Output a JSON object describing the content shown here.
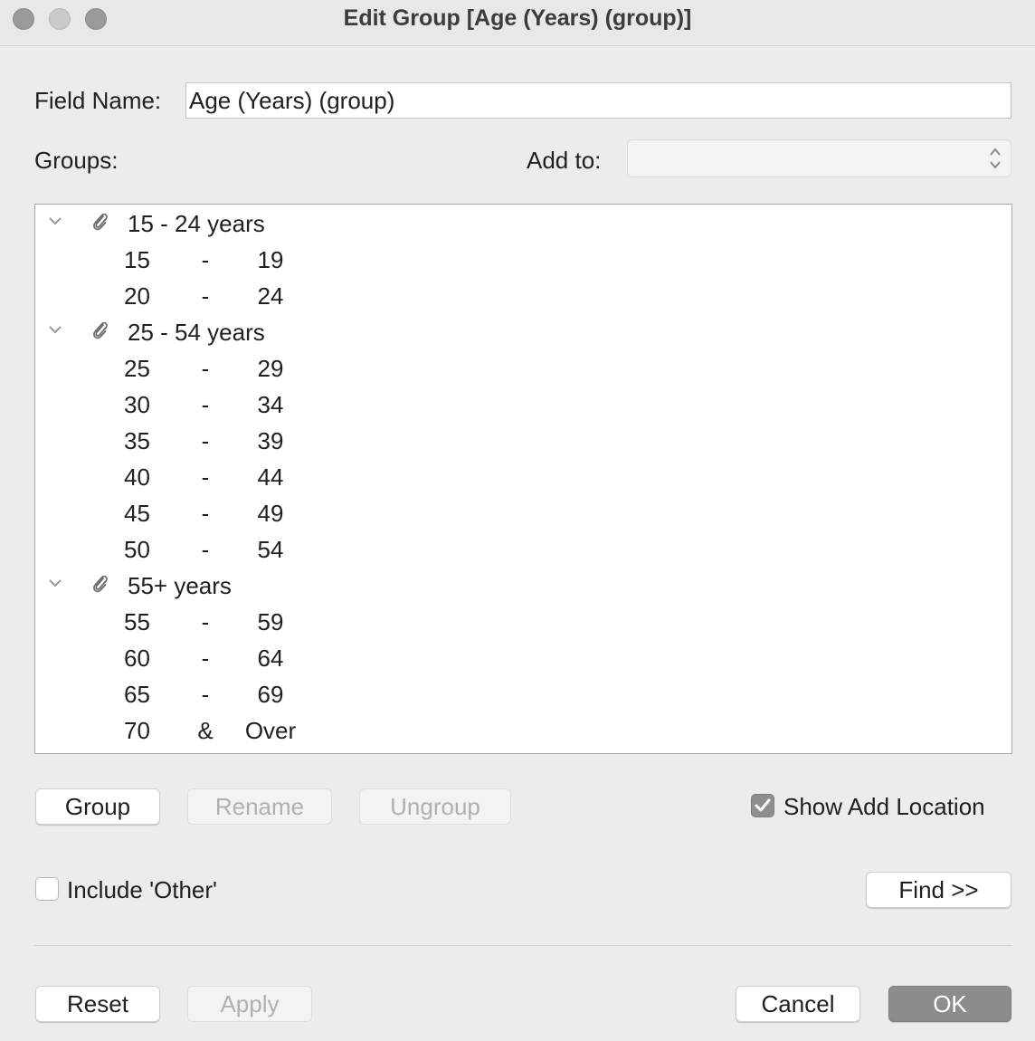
{
  "window": {
    "title": "Edit Group [Age (Years) (group)]"
  },
  "field_name": {
    "label": "Field Name:",
    "value": "Age (Years) (group)"
  },
  "groups_label": "Groups:",
  "add_to": {
    "label": "Add to:",
    "value": ""
  },
  "tree": {
    "groups": [
      {
        "label": "15 - 24 years",
        "members": [
          [
            "15",
            "-",
            "19"
          ],
          [
            "20",
            "-",
            "24"
          ]
        ]
      },
      {
        "label": "25 - 54 years",
        "members": [
          [
            "25",
            "-",
            "29"
          ],
          [
            "30",
            "-",
            "34"
          ],
          [
            "35",
            "-",
            "39"
          ],
          [
            "40",
            "-",
            "44"
          ],
          [
            "45",
            "-",
            "49"
          ],
          [
            "50",
            "-",
            "54"
          ]
        ]
      },
      {
        "label": "55+ years",
        "members": [
          [
            "55",
            "-",
            "59"
          ],
          [
            "60",
            "-",
            "64"
          ],
          [
            "65",
            "-",
            "69"
          ],
          [
            "70",
            "&",
            "Over"
          ]
        ]
      }
    ]
  },
  "buttons": {
    "group": "Group",
    "rename": "Rename",
    "ungroup": "Ungroup",
    "find": "Find >>",
    "reset": "Reset",
    "apply": "Apply",
    "cancel": "Cancel",
    "ok": "OK"
  },
  "show_add_location": {
    "label": "Show Add Location",
    "checked": true
  },
  "include_other": {
    "label": "Include 'Other'",
    "checked": false
  },
  "colors": {
    "background": "#ececec",
    "primary_button": "#8d8d8d",
    "checkbox_checked": "#8e8e8e"
  }
}
